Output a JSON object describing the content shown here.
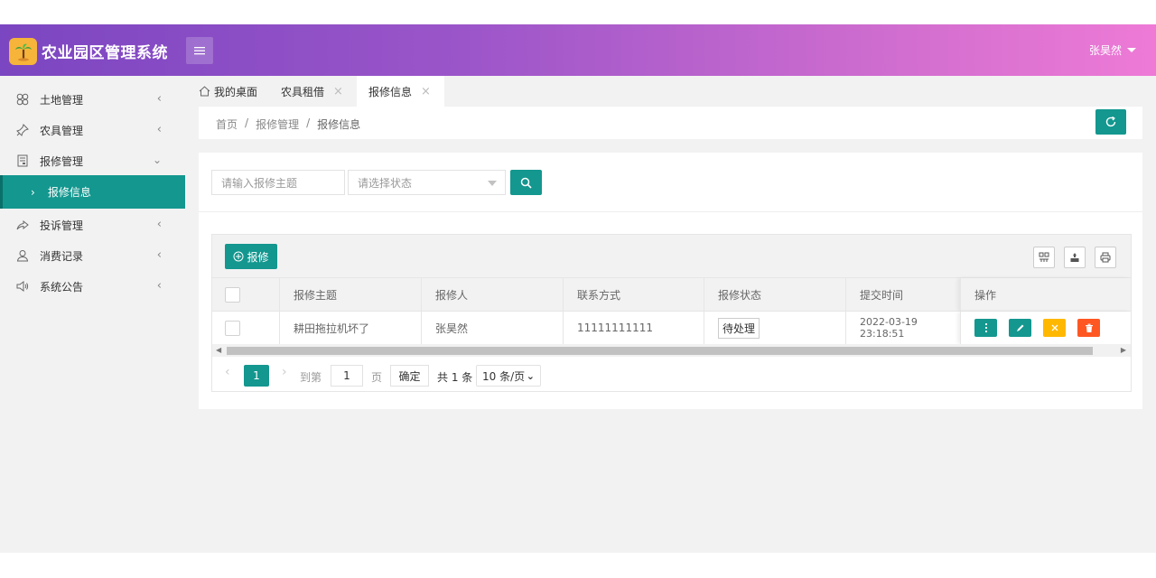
{
  "header": {
    "app_title": "农业园区管理系统",
    "user_name": "张昊然"
  },
  "sidebar": {
    "items": [
      {
        "label": "土地管理",
        "icon": "clover-icon"
      },
      {
        "label": "农具管理",
        "icon": "pin-icon"
      },
      {
        "label": "报修管理",
        "icon": "form-icon"
      },
      {
        "label": "投诉管理",
        "icon": "share-icon"
      },
      {
        "label": "消费记录",
        "icon": "user-icon"
      },
      {
        "label": "系统公告",
        "icon": "speaker-icon"
      }
    ],
    "active_sub": "报修信息"
  },
  "tabs": [
    {
      "label": "我的桌面"
    },
    {
      "label": "农具租借"
    },
    {
      "label": "报修信息"
    }
  ],
  "breadcrumb": [
    "首页",
    "报修管理",
    "报修信息"
  ],
  "breadcrumb_sep": "/",
  "search": {
    "subject_placeholder": "请输入报修主题",
    "status_placeholder": "请选择状态"
  },
  "toolbar": {
    "add_label": "报修"
  },
  "table": {
    "columns": [
      "报修主题",
      "报修人",
      "联系方式",
      "报修状态",
      "提交时间",
      "操作"
    ],
    "rows": [
      {
        "subject": "耕田拖拉机坏了",
        "reporter": "张昊然",
        "contact": "11111111111",
        "status": "待处理",
        "submitted": "2022-03-19 23:18:51"
      }
    ]
  },
  "pager": {
    "current_page": "1",
    "goto_label": "到第",
    "page_input": "1",
    "page_suffix": "页",
    "confirm_label": "确定",
    "total_label": "共 1 条",
    "page_size": "10 条/页"
  },
  "colors": {
    "accent": "#13978f",
    "header_start": "#7b46c1",
    "header_end": "#ee7ad6",
    "warn": "#ffb800",
    "danger": "#ff5722"
  }
}
